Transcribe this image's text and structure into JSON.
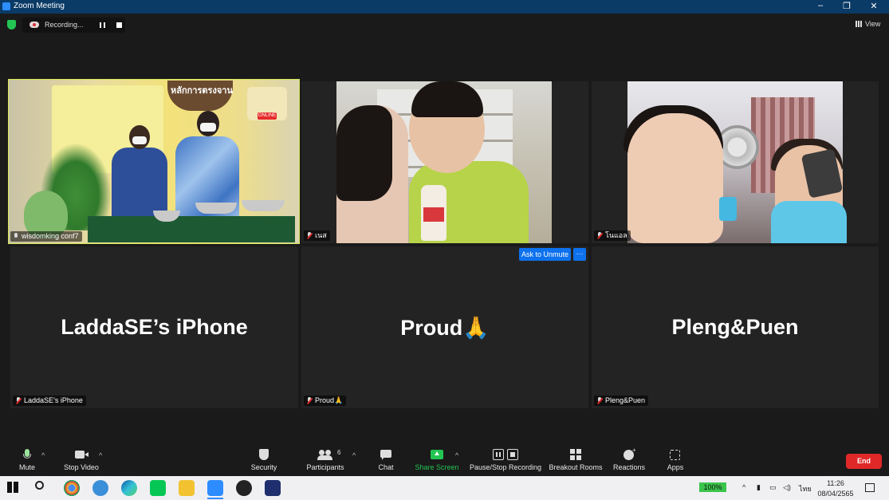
{
  "window": {
    "title": "Zoom Meeting",
    "controls": [
      "–",
      "❐",
      "✕"
    ]
  },
  "recording": {
    "label": "Recording...",
    "pause_icon": "pause-icon",
    "stop_icon": "stop-icon"
  },
  "view_button": {
    "label": "View"
  },
  "tiles": [
    {
      "name": "wisdomking conf7",
      "mic": "unmuted"
    },
    {
      "name": "เนส",
      "mic": "muted"
    },
    {
      "name": "โนแอล",
      "mic": "muted"
    },
    {
      "name": "LaddaSE’s iPhone",
      "mic": "muted",
      "display_name": "LaddaSE’s iPhone"
    },
    {
      "name": "Proud🙏",
      "mic": "muted",
      "display_name": "Proud🙏"
    },
    {
      "name": "Pleng&Puen",
      "mic": "muted",
      "display_name": "Pleng&Puen"
    }
  ],
  "video1": {
    "sign_text": "หลักการตรงจาน",
    "online_badge": "ONLINE"
  },
  "ask_to_unmute": {
    "label": "Ask to Unmute",
    "more": "···"
  },
  "toolbar": {
    "mute": "Mute",
    "stop_video": "Stop Video",
    "security": "Security",
    "participants": "Participants",
    "participants_count": "6",
    "chat": "Chat",
    "share_screen": "Share Screen",
    "pause_stop_recording": "Pause/Stop Recording",
    "breakout_rooms": "Breakout Rooms",
    "reactions": "Reactions",
    "apps": "Apps",
    "end": "End",
    "share_color": "#23c552",
    "end_color": "#e02828"
  },
  "taskbar": {
    "battery": "100%",
    "language": "ไทย",
    "time": "11:26",
    "date": "08/04/2565"
  }
}
